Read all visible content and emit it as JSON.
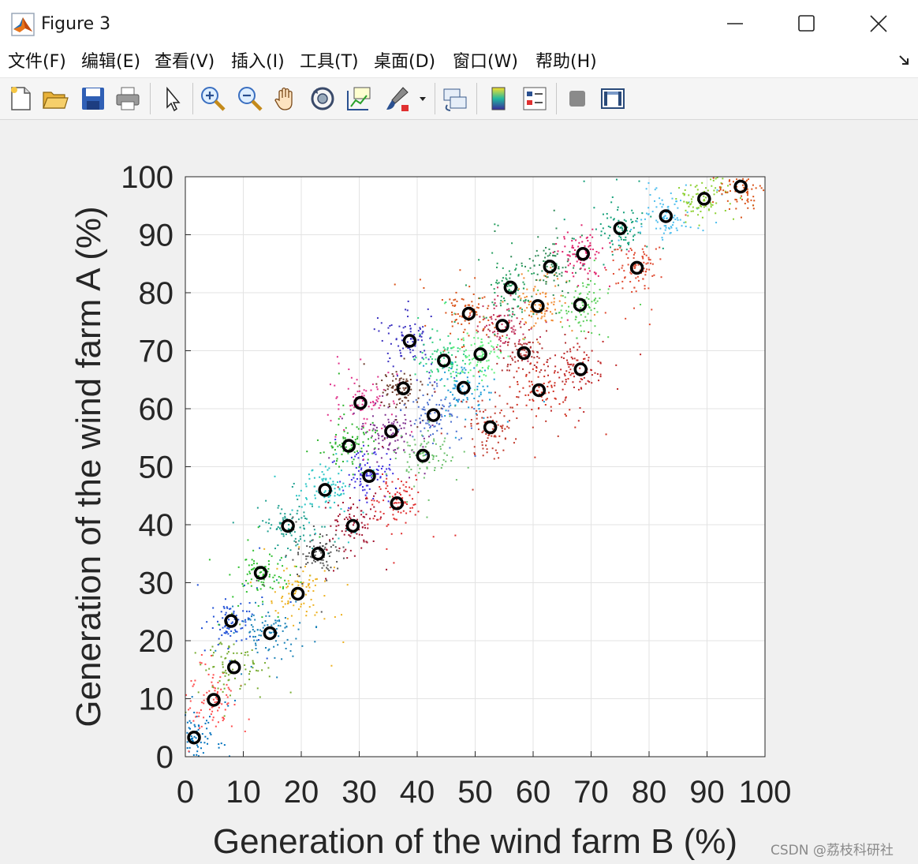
{
  "window": {
    "title": "Figure 3",
    "controls": [
      "minimize",
      "maximize",
      "close"
    ]
  },
  "menu": {
    "items": [
      "文件(F)",
      "编辑(E)",
      "查看(V)",
      "插入(I)",
      "工具(T)",
      "桌面(D)",
      "窗口(W)",
      "帮助(H)"
    ]
  },
  "toolbar": {
    "tools": [
      {
        "icon": "new-figure-icon"
      },
      {
        "icon": "open-file-icon"
      },
      {
        "icon": "save-icon"
      },
      {
        "icon": "print-icon"
      },
      {
        "icon": "edit-plot-arrow-icon"
      },
      {
        "icon": "zoom-in-icon"
      },
      {
        "icon": "zoom-out-icon"
      },
      {
        "icon": "pan-hand-icon"
      },
      {
        "icon": "rotate-3d-icon"
      },
      {
        "icon": "data-cursor-icon"
      },
      {
        "icon": "brush-icon"
      },
      {
        "icon": "brush-dropdown-icon"
      },
      {
        "icon": "link-plot-icon"
      },
      {
        "icon": "colorbar-icon"
      },
      {
        "icon": "legend-icon"
      },
      {
        "icon": "hide-plot-tools-icon"
      },
      {
        "icon": "show-plot-tools-icon"
      }
    ]
  },
  "chart_data": {
    "type": "scatter",
    "xlabel": "Generation of the wind farm B (%)",
    "ylabel": "Generation of the wind farm A (%)",
    "xlim": [
      0,
      100
    ],
    "ylim": [
      0,
      100
    ],
    "xticks": [
      0,
      10,
      20,
      30,
      40,
      50,
      60,
      70,
      80,
      90,
      100
    ],
    "yticks": [
      0,
      10,
      20,
      30,
      40,
      50,
      60,
      70,
      80,
      90,
      100
    ],
    "grid": true,
    "background_color": "#ffffff",
    "centroid_marker": "black open circle",
    "clusters": [
      {
        "center": [
          1.5,
          3.3
        ],
        "color": "#0072bd"
      },
      {
        "center": [
          4.9,
          9.8
        ],
        "color": "#ff4d4d"
      },
      {
        "center": [
          8.4,
          15.4
        ],
        "color": "#77ac30"
      },
      {
        "center": [
          7.9,
          23.4
        ],
        "color": "#1f4fd6"
      },
      {
        "center": [
          14.6,
          21.3
        ],
        "color": "#1982b8"
      },
      {
        "center": [
          13.0,
          31.7
        ],
        "color": "#2fc02f"
      },
      {
        "center": [
          19.4,
          28.1
        ],
        "color": "#edb120"
      },
      {
        "center": [
          17.7,
          39.8
        ],
        "color": "#20a090"
      },
      {
        "center": [
          22.9,
          35.0
        ],
        "color": "#555555"
      },
      {
        "center": [
          24.1,
          46.0
        ],
        "color": "#27c4c4"
      },
      {
        "center": [
          28.9,
          39.8
        ],
        "color": "#a2142f"
      },
      {
        "center": [
          28.2,
          53.6
        ],
        "color": "#2cb42c"
      },
      {
        "center": [
          31.7,
          48.4
        ],
        "color": "#3c2ee0"
      },
      {
        "center": [
          30.2,
          61.0
        ],
        "color": "#e0308a"
      },
      {
        "center": [
          36.5,
          43.7
        ],
        "color": "#e03030"
      },
      {
        "center": [
          35.5,
          56.1
        ],
        "color": "#7e2f8e"
      },
      {
        "center": [
          37.6,
          63.5
        ],
        "color": "#6b3a2a"
      },
      {
        "center": [
          38.7,
          71.7
        ],
        "color": "#3a30c0"
      },
      {
        "center": [
          41.0,
          51.9
        ],
        "color": "#6cc06c"
      },
      {
        "center": [
          42.8,
          58.9
        ],
        "color": "#4a6fd0"
      },
      {
        "center": [
          44.6,
          68.3
        ],
        "color": "#30d080"
      },
      {
        "center": [
          48.0,
          63.6
        ],
        "color": "#1a9ad6"
      },
      {
        "center": [
          48.9,
          76.4
        ],
        "color": "#d95319"
      },
      {
        "center": [
          50.9,
          69.4
        ],
        "color": "#5ef07a"
      },
      {
        "center": [
          52.6,
          56.8
        ],
        "color": "#c0392b"
      },
      {
        "center": [
          54.7,
          74.3
        ],
        "color": "#c0305a"
      },
      {
        "center": [
          56.1,
          80.9
        ],
        "color": "#27a060"
      },
      {
        "center": [
          58.4,
          69.6
        ],
        "color": "#b03030"
      },
      {
        "center": [
          60.8,
          77.7
        ],
        "color": "#f08a30"
      },
      {
        "center": [
          61.0,
          63.2
        ],
        "color": "#d03020"
      },
      {
        "center": [
          62.9,
          84.5
        ],
        "color": "#2e8b57"
      },
      {
        "center": [
          68.1,
          77.9
        ],
        "color": "#5cd05c"
      },
      {
        "center": [
          68.2,
          66.8
        ],
        "color": "#c02828"
      },
      {
        "center": [
          68.6,
          86.7
        ],
        "color": "#e0206a"
      },
      {
        "center": [
          75.0,
          91.1
        ],
        "color": "#15a07a"
      },
      {
        "center": [
          77.9,
          84.3
        ],
        "color": "#e04a30"
      },
      {
        "center": [
          82.9,
          93.2
        ],
        "color": "#4dbeee"
      },
      {
        "center": [
          89.5,
          96.2
        ],
        "color": "#8cd030"
      },
      {
        "center": [
          95.8,
          98.3
        ],
        "color": "#d95319"
      }
    ]
  },
  "watermark": "CSDN @荔枝科研社"
}
